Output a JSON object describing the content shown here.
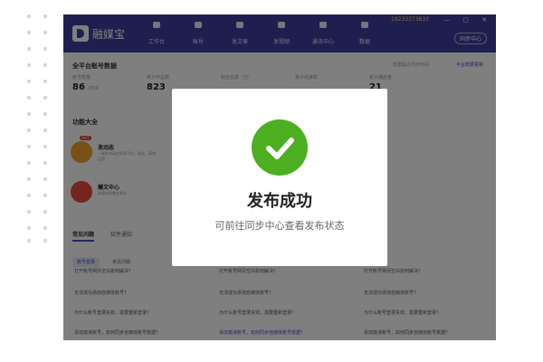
{
  "app": {
    "brand": "融媒宝",
    "phone": "19233373833",
    "sync_label": "同步中心",
    "nav": [
      {
        "label": "工作台",
        "icon": "chat-icon"
      },
      {
        "label": "账号",
        "icon": "user-icon"
      },
      {
        "label": "发文章",
        "icon": "pen-icon"
      },
      {
        "label": "发视频",
        "icon": "video-icon"
      },
      {
        "label": "通讯中心",
        "icon": "home-icon"
      },
      {
        "label": "数据",
        "icon": "data-icon"
      }
    ]
  },
  "overview": {
    "title": "全平台账号数据",
    "update_note": "数据最近同步时间",
    "link": "平台数据更新",
    "stats": [
      {
        "label": "账号数量",
        "value": "86",
        "unit": "/200"
      },
      {
        "label": "累计作品数",
        "value": "823",
        "unit": ""
      },
      {
        "label": "粉丝总数（万）",
        "value": "",
        "unit": ""
      },
      {
        "label": "累计阅读数",
        "value": "",
        "unit": ""
      },
      {
        "label": "累计播放量",
        "value": "21",
        "unit": ""
      }
    ]
  },
  "features": {
    "title": "功能大全",
    "items": [
      {
        "title": "发动态",
        "desc": "一键发布动态到多平台，轻松、高效运营",
        "badge": "HOT",
        "color": "#f0a030",
        "icon": "send-icon"
      },
      {
        "title": "爆文中心",
        "desc": "海量优质爆文素材",
        "badge": "",
        "color": "#e84c3d",
        "icon": "flame-icon"
      }
    ]
  },
  "faq": {
    "tabs": [
      "常见问题",
      "软件通知"
    ],
    "subtabs": [
      "账号登录",
      "常见问题"
    ],
    "items": [
      "打开账号网页空白如何解决？",
      "打开账号网页空白如何解决？",
      "打开账号网页空白如何解决？",
      "无法成功添加自媒体账号？",
      "无法成功添加自媒体账号？",
      "无法成功添加自媒体账号？",
      "为什么账号登录失效，需要重新登录？",
      "为什么账号登录失效，需要重新登录？",
      "为什么账号登录失效，需要重新登录？",
      "添加错误账号，如何同步自媒体账号数据？",
      "添加错误账号，如何同步自媒体账号数据？",
      "添加错误账号，如何同步自媒体账号数据？"
    ]
  },
  "modal": {
    "title": "发布成功",
    "subtitle": "可前往同步中心查看发布状态",
    "icon": "success-check-icon",
    "color": "#4caf1f"
  }
}
